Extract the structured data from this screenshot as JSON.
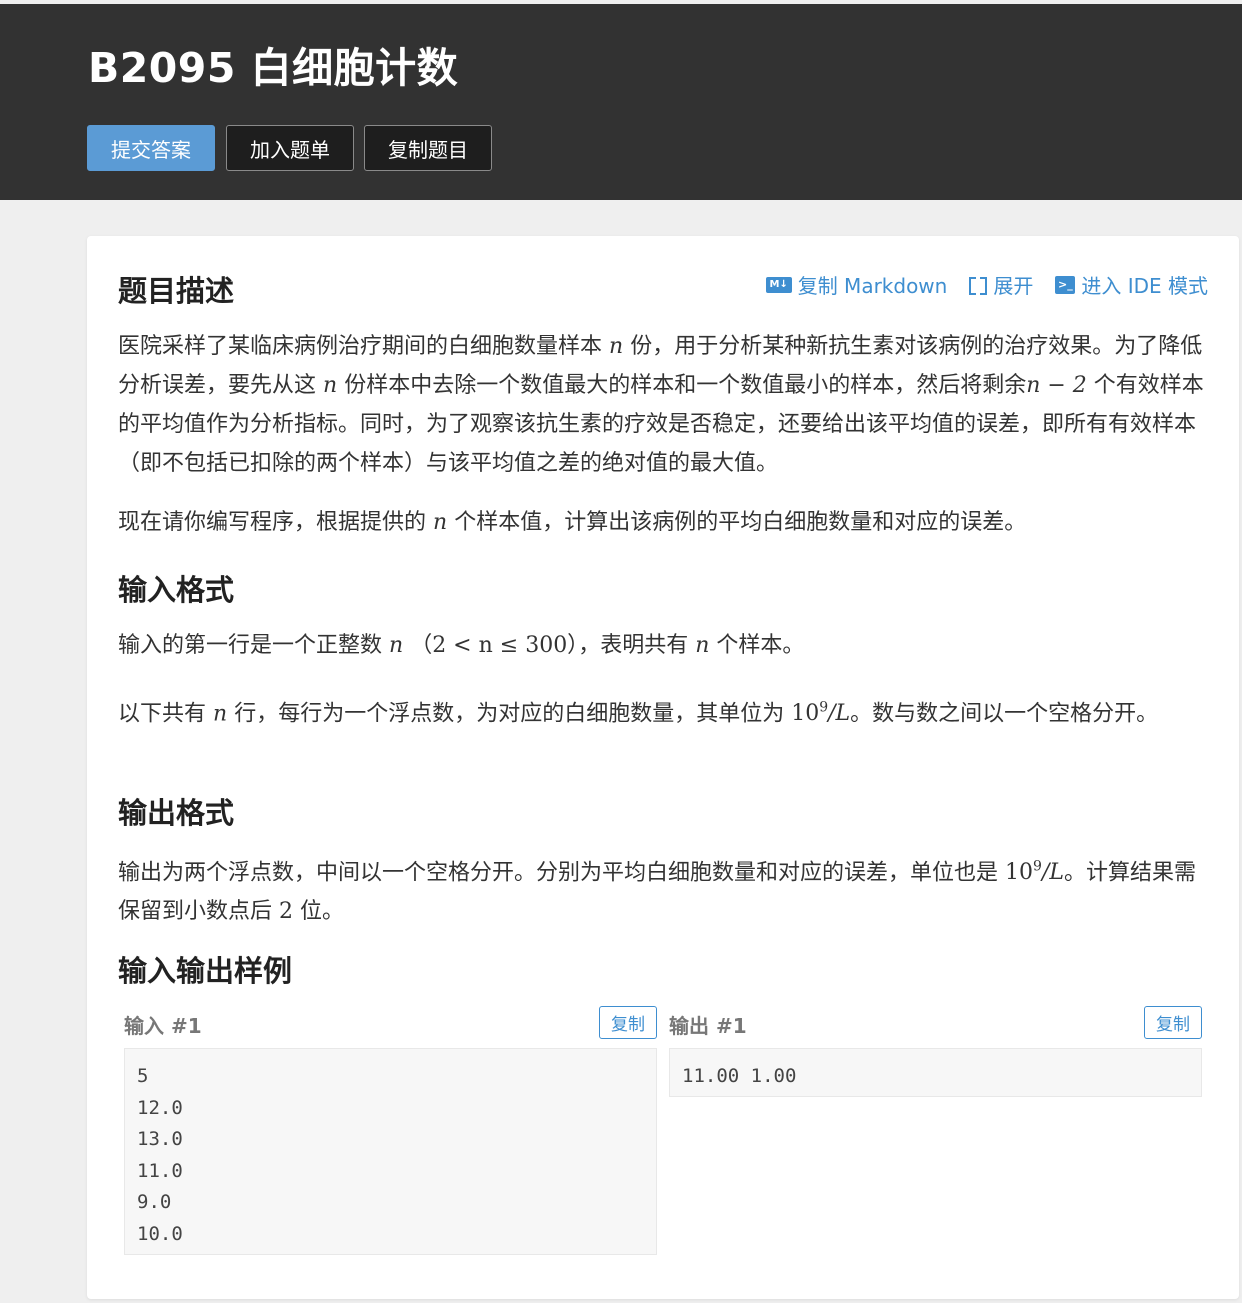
{
  "header": {
    "title": "B2095 白细胞计数",
    "buttons": {
      "submit": "提交答案",
      "add_to_list": "加入题单",
      "copy_problem": "复制题目"
    }
  },
  "card": {
    "title": "题目描述",
    "tools": {
      "copy_markdown": "复制 Markdown",
      "md_badge": "M↓",
      "expand": "展开",
      "ide_mode": "进入 IDE 模式",
      "ide_badge": ">_"
    },
    "description": {
      "p1_a": "医院采样了某临床病例治疗期间的白细胞数量样本",
      "p1_var": "n",
      "p1_b": "份，用于分析某种新抗生素对该病例的治疗效果。为了降低分析误差，要先从这",
      "p1_var2": "n",
      "p1_c": "份样本中去除一个数值最大的样本和一个数值最小的样本，然后将剩余",
      "p1_expr": "n − 2",
      "p1_d": "个有效样本的平均值作为分析指标。同时，为了观察该抗生素的疗效是否稳定，还要给出该平均值的误差，即所有有效样本（即不包括已扣除的两个样本）与该平均值之差的绝对值的最大值。",
      "p2_a": "现在请你编写程序，根据提供的",
      "p2_var": "n",
      "p2_b": "个样本值，计算出该病例的平均白细胞数量和对应的误差。"
    },
    "input_format": {
      "heading": "输入格式",
      "p1_a": "输入的第一行是一个正整数",
      "p1_var": "n",
      "p1_cond": "（2 < n ≤ 300）",
      "p1_b": "，表明共有",
      "p1_var2": "n",
      "p1_c": "个样本。",
      "p2_a": "以下共有",
      "p2_var": "n",
      "p2_b": "行，每行为一个浮点数，为对应的白细胞数量，其单位为",
      "p2_unit_base": "10",
      "p2_unit_exp": "9",
      "p2_unit_tail": "/L",
      "p2_c": "。数与数之间以一个空格分开。"
    },
    "output_format": {
      "heading": "输出格式",
      "p1_a": "输出为两个浮点数，中间以一个空格分开。分别为平均白细胞数量和对应的误差，单位也是",
      "p1_unit_base": "10",
      "p1_unit_exp": "9",
      "p1_unit_tail": "/L",
      "p1_b": "。计算结果需保留到小数点后",
      "p1_num": "2",
      "p1_c": "位。"
    },
    "samples": {
      "heading": "输入输出样例",
      "input_label": "输入 #1",
      "output_label": "输出 #1",
      "copy_label": "复制",
      "input_lines": [
        "5",
        "12.0",
        "13.0",
        "11.0",
        "9.0",
        "10.0"
      ],
      "output_lines": [
        "11.00 1.00"
      ]
    }
  }
}
